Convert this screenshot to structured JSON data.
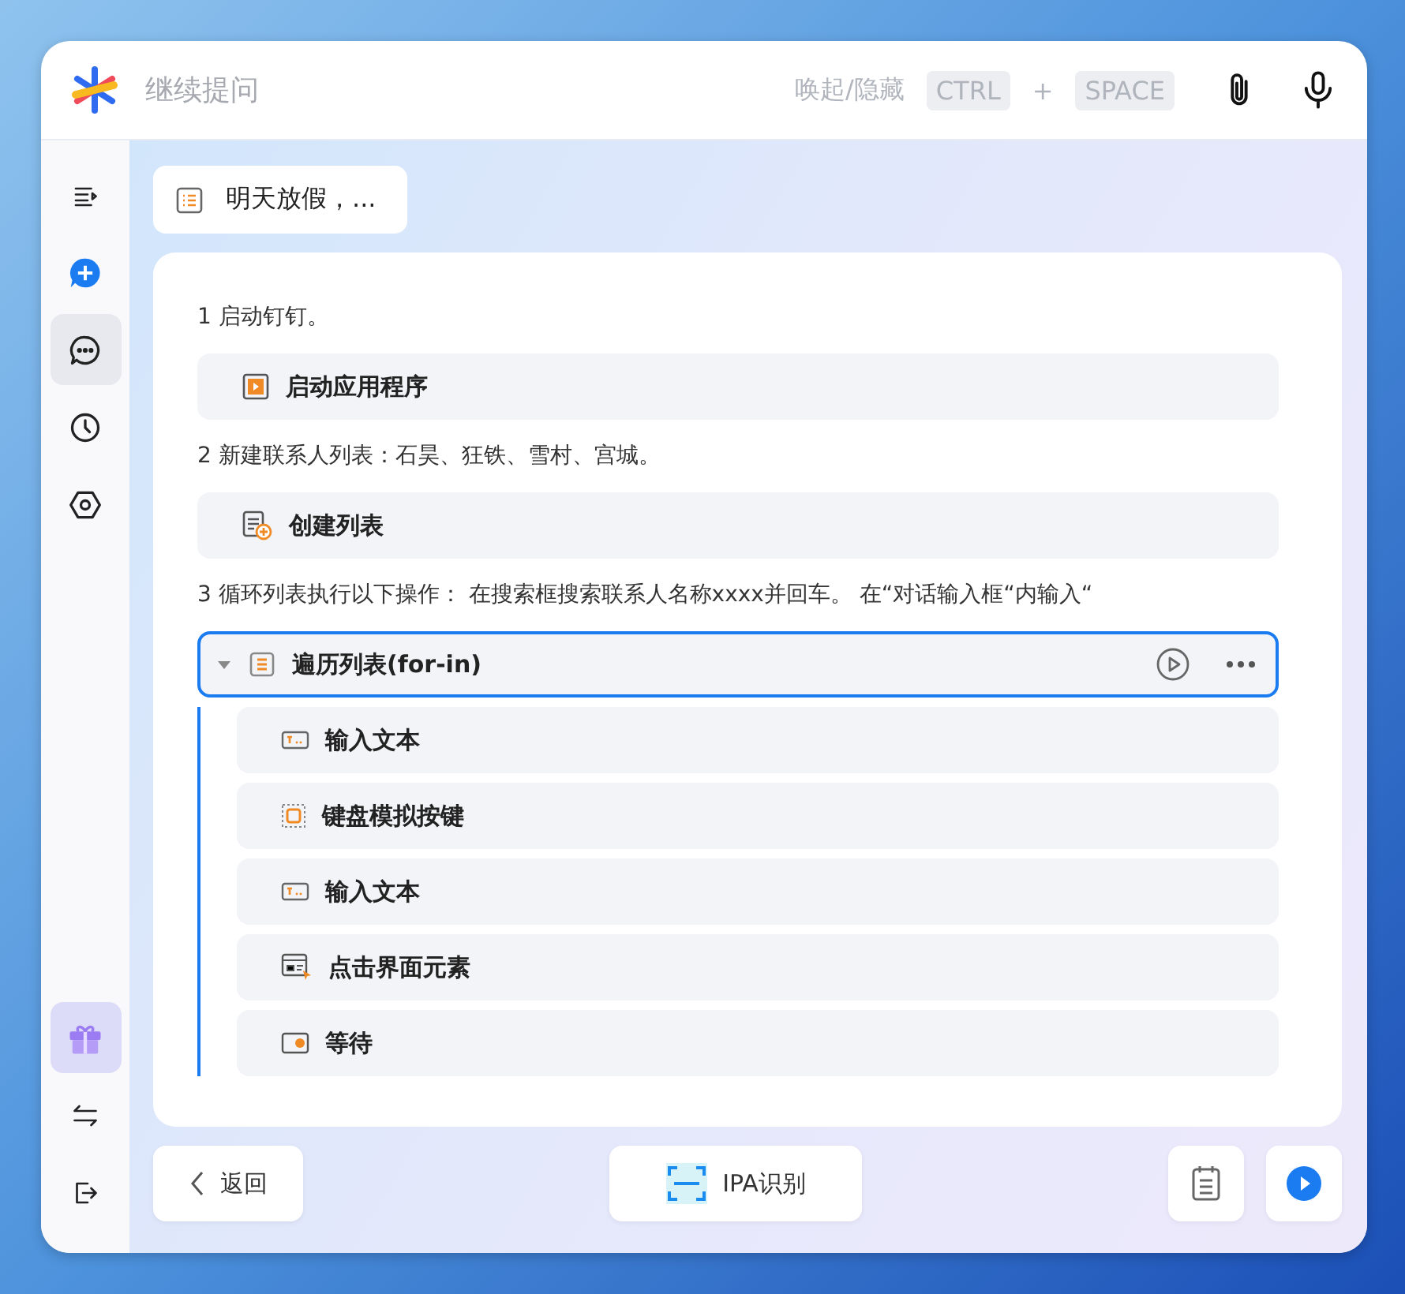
{
  "header": {
    "placeholder": "继续提问",
    "shortcut_label": "唤起/隐藏",
    "keys": [
      "CTRL",
      "SPACE"
    ],
    "plus": "+"
  },
  "sidebar": {
    "top": [
      {
        "kind": "collapse",
        "selected": false
      },
      {
        "kind": "new-chat",
        "selected": false
      },
      {
        "kind": "chat",
        "selected": true
      },
      {
        "kind": "history",
        "selected": false
      },
      {
        "kind": "settings",
        "selected": false
      }
    ],
    "bottom": [
      {
        "kind": "gift"
      },
      {
        "kind": "switch"
      },
      {
        "kind": "logout"
      }
    ]
  },
  "task_tab": {
    "label": "明天放假，..."
  },
  "steps": [
    {
      "kind": "text",
      "text": "1 启动钉钉。"
    },
    {
      "kind": "launch",
      "label": "启动应用程序"
    },
    {
      "kind": "text",
      "text": "2 新建联系人列表：石昊、狂铁、雪村、宫城。"
    },
    {
      "kind": "list",
      "label": "创建列表"
    },
    {
      "kind": "text",
      "text": "3 循环列表执行以下操作： 在搜索框搜索联系人名称xxxx并回车。 在“对话输入框“内输入“"
    },
    {
      "kind": "loop",
      "label": "遍历列表(for-in)",
      "expanded": true,
      "selected": true,
      "children": [
        {
          "kind": "input",
          "label": "输入文本"
        },
        {
          "kind": "key",
          "label": "键盘模拟按键"
        },
        {
          "kind": "input",
          "label": "输入文本"
        },
        {
          "kind": "click",
          "label": "点击界面元素"
        },
        {
          "kind": "wait",
          "label": "等待"
        }
      ]
    }
  ],
  "footer": {
    "back": "返回",
    "recognize": "IPA识别"
  }
}
